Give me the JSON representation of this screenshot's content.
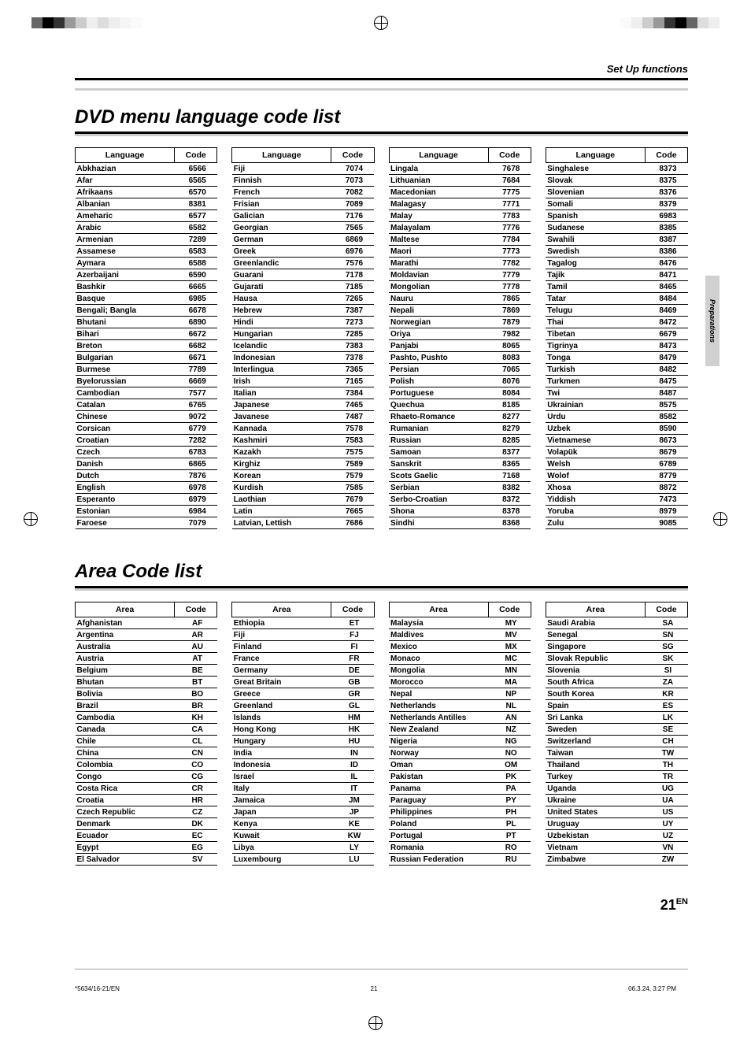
{
  "header": {
    "set_up": "Set Up functions"
  },
  "section1": {
    "title": "DVD menu language code list",
    "col_lang": "Language",
    "col_code": "Code",
    "columns": [
      [
        [
          "Abkhazian",
          "6566"
        ],
        [
          "Afar",
          "6565"
        ],
        [
          "Afrikaans",
          "6570"
        ],
        [
          "Albanian",
          "8381"
        ],
        [
          "Ameharic",
          "6577"
        ],
        [
          "Arabic",
          "6582"
        ],
        [
          "Armenian",
          "7289"
        ],
        [
          "Assamese",
          "6583"
        ],
        [
          "Aymara",
          "6588"
        ],
        [
          "Azerbaijani",
          "6590"
        ],
        [
          "Bashkir",
          "6665"
        ],
        [
          "Basque",
          "6985"
        ],
        [
          "Bengali; Bangla",
          "6678"
        ],
        [
          "Bhutani",
          "6890"
        ],
        [
          "Bihari",
          "6672"
        ],
        [
          "Breton",
          "6682"
        ],
        [
          "Bulgarian",
          "6671"
        ],
        [
          "Burmese",
          "7789"
        ],
        [
          "Byelorussian",
          "6669"
        ],
        [
          "Cambodian",
          "7577"
        ],
        [
          "Catalan",
          "6765"
        ],
        [
          "Chinese",
          "9072"
        ],
        [
          "Corsican",
          "6779"
        ],
        [
          "Croatian",
          "7282"
        ],
        [
          "Czech",
          "6783"
        ],
        [
          "Danish",
          "6865"
        ],
        [
          "Dutch",
          "7876"
        ],
        [
          "English",
          "6978"
        ],
        [
          "Esperanto",
          "6979"
        ],
        [
          "Estonian",
          "6984"
        ],
        [
          "Faroese",
          "7079"
        ]
      ],
      [
        [
          "Fiji",
          "7074"
        ],
        [
          "Finnish",
          "7073"
        ],
        [
          "French",
          "7082"
        ],
        [
          "Frisian",
          "7089"
        ],
        [
          "Galician",
          "7176"
        ],
        [
          "Georgian",
          "7565"
        ],
        [
          "German",
          "6869"
        ],
        [
          "Greek",
          "6976"
        ],
        [
          "Greenlandic",
          "7576"
        ],
        [
          "Guarani",
          "7178"
        ],
        [
          "Gujarati",
          "7185"
        ],
        [
          "Hausa",
          "7265"
        ],
        [
          "Hebrew",
          "7387"
        ],
        [
          "Hindi",
          "7273"
        ],
        [
          "Hungarian",
          "7285"
        ],
        [
          "Icelandic",
          "7383"
        ],
        [
          "Indonesian",
          "7378"
        ],
        [
          "Interlingua",
          "7365"
        ],
        [
          "Irish",
          "7165"
        ],
        [
          "Italian",
          "7384"
        ],
        [
          "Japanese",
          "7465"
        ],
        [
          "Javanese",
          "7487"
        ],
        [
          "Kannada",
          "7578"
        ],
        [
          "Kashmiri",
          "7583"
        ],
        [
          "Kazakh",
          "7575"
        ],
        [
          "Kirghiz",
          "7589"
        ],
        [
          "Korean",
          "7579"
        ],
        [
          "Kurdish",
          "7585"
        ],
        [
          "Laothian",
          "7679"
        ],
        [
          "Latin",
          "7665"
        ],
        [
          "Latvian, Lettish",
          "7686"
        ]
      ],
      [
        [
          "Lingala",
          "7678"
        ],
        [
          "Lithuanian",
          "7684"
        ],
        [
          "Macedonian",
          "7775"
        ],
        [
          "Malagasy",
          "7771"
        ],
        [
          "Malay",
          "7783"
        ],
        [
          "Malayalam",
          "7776"
        ],
        [
          "Maltese",
          "7784"
        ],
        [
          "Maori",
          "7773"
        ],
        [
          "Marathi",
          "7782"
        ],
        [
          "Moldavian",
          "7779"
        ],
        [
          "Mongolian",
          "7778"
        ],
        [
          "Nauru",
          "7865"
        ],
        [
          "Nepali",
          "7869"
        ],
        [
          "Norwegian",
          "7879"
        ],
        [
          "Oriya",
          "7982"
        ],
        [
          "Panjabi",
          "8065"
        ],
        [
          "Pashto, Pushto",
          "8083"
        ],
        [
          "Persian",
          "7065"
        ],
        [
          "Polish",
          "8076"
        ],
        [
          "Portuguese",
          "8084"
        ],
        [
          "Quechua",
          "8185"
        ],
        [
          "Rhaeto-Romance",
          "8277"
        ],
        [
          "Rumanian",
          "8279"
        ],
        [
          "Russian",
          "8285"
        ],
        [
          "Samoan",
          "8377"
        ],
        [
          "Sanskrit",
          "8365"
        ],
        [
          "Scots Gaelic",
          "7168"
        ],
        [
          "Serbian",
          "8382"
        ],
        [
          "Serbo-Croatian",
          "8372"
        ],
        [
          "Shona",
          "8378"
        ],
        [
          "Sindhi",
          "8368"
        ]
      ],
      [
        [
          "Singhalese",
          "8373"
        ],
        [
          "Slovak",
          "8375"
        ],
        [
          "Slovenian",
          "8376"
        ],
        [
          "Somali",
          "8379"
        ],
        [
          "Spanish",
          "6983"
        ],
        [
          "Sudanese",
          "8385"
        ],
        [
          "Swahili",
          "8387"
        ],
        [
          "Swedish",
          "8386"
        ],
        [
          "Tagalog",
          "8476"
        ],
        [
          "Tajik",
          "8471"
        ],
        [
          "Tamil",
          "8465"
        ],
        [
          "Tatar",
          "8484"
        ],
        [
          "Telugu",
          "8469"
        ],
        [
          "Thai",
          "8472"
        ],
        [
          "Tibetan",
          "6679"
        ],
        [
          "Tigrinya",
          "8473"
        ],
        [
          "Tonga",
          "8479"
        ],
        [
          "Turkish",
          "8482"
        ],
        [
          "Turkmen",
          "8475"
        ],
        [
          "Twi",
          "8487"
        ],
        [
          "Ukrainian",
          "8575"
        ],
        [
          "Urdu",
          "8582"
        ],
        [
          "Uzbek",
          "8590"
        ],
        [
          "Vietnamese",
          "8673"
        ],
        [
          "Volapük",
          "8679"
        ],
        [
          "Welsh",
          "6789"
        ],
        [
          "Wolof",
          "8779"
        ],
        [
          "Xhosa",
          "8872"
        ],
        [
          "Yiddish",
          "7473"
        ],
        [
          "Yoruba",
          "8979"
        ],
        [
          "Zulu",
          "9085"
        ]
      ]
    ]
  },
  "section2": {
    "title": "Area Code list",
    "col_area": "Area",
    "col_code": "Code",
    "columns": [
      [
        [
          "Afghanistan",
          "AF"
        ],
        [
          "Argentina",
          "AR"
        ],
        [
          "Australia",
          "AU"
        ],
        [
          "Austria",
          "AT"
        ],
        [
          "Belgium",
          "BE"
        ],
        [
          "Bhutan",
          "BT"
        ],
        [
          "Bolivia",
          "BO"
        ],
        [
          "Brazil",
          "BR"
        ],
        [
          "Cambodia",
          "KH"
        ],
        [
          "Canada",
          "CA"
        ],
        [
          "Chile",
          "CL"
        ],
        [
          "China",
          "CN"
        ],
        [
          "Colombia",
          "CO"
        ],
        [
          "Congo",
          "CG"
        ],
        [
          "Costa Rica",
          "CR"
        ],
        [
          "Croatia",
          "HR"
        ],
        [
          "Czech Republic",
          "CZ"
        ],
        [
          "Denmark",
          "DK"
        ],
        [
          "Ecuador",
          "EC"
        ],
        [
          "Egypt",
          "EG"
        ],
        [
          "El Salvador",
          "SV"
        ]
      ],
      [
        [
          "Ethiopia",
          "ET"
        ],
        [
          "Fiji",
          "FJ"
        ],
        [
          "Finland",
          "FI"
        ],
        [
          "France",
          "FR"
        ],
        [
          "Germany",
          "DE"
        ],
        [
          "Great Britain",
          "GB"
        ],
        [
          "Greece",
          "GR"
        ],
        [
          "Greenland",
          "GL"
        ],
        [
          "Islands",
          "HM"
        ],
        [
          "Hong Kong",
          "HK"
        ],
        [
          "Hungary",
          "HU"
        ],
        [
          "India",
          "IN"
        ],
        [
          "Indonesia",
          "ID"
        ],
        [
          "Israel",
          "IL"
        ],
        [
          "Italy",
          "IT"
        ],
        [
          "Jamaica",
          "JM"
        ],
        [
          "Japan",
          "JP"
        ],
        [
          "Kenya",
          "KE"
        ],
        [
          "Kuwait",
          "KW"
        ],
        [
          "Libya",
          "LY"
        ],
        [
          "Luxembourg",
          "LU"
        ]
      ],
      [
        [
          "Malaysia",
          "MY"
        ],
        [
          "Maldives",
          "MV"
        ],
        [
          "Mexico",
          "MX"
        ],
        [
          "Monaco",
          "MC"
        ],
        [
          "Mongolia",
          "MN"
        ],
        [
          "Morocco",
          "MA"
        ],
        [
          "Nepal",
          "NP"
        ],
        [
          "Netherlands",
          "NL"
        ],
        [
          "Netherlands Antilles",
          "AN"
        ],
        [
          "New Zealand",
          "NZ"
        ],
        [
          "Nigeria",
          "NG"
        ],
        [
          "Norway",
          "NO"
        ],
        [
          "Oman",
          "OM"
        ],
        [
          "Pakistan",
          "PK"
        ],
        [
          "Panama",
          "PA"
        ],
        [
          "Paraguay",
          "PY"
        ],
        [
          "Philippines",
          "PH"
        ],
        [
          "Poland",
          "PL"
        ],
        [
          "Portugal",
          "PT"
        ],
        [
          "Romania",
          "RO"
        ],
        [
          "Russian Federation",
          "RU"
        ]
      ],
      [
        [
          "Saudi Arabia",
          "SA"
        ],
        [
          "Senegal",
          "SN"
        ],
        [
          "Singapore",
          "SG"
        ],
        [
          "Slovak Republic",
          "SK"
        ],
        [
          "Slovenia",
          "SI"
        ],
        [
          "South Africa",
          "ZA"
        ],
        [
          "South Korea",
          "KR"
        ],
        [
          "Spain",
          "ES"
        ],
        [
          "Sri Lanka",
          "LK"
        ],
        [
          "Sweden",
          "SE"
        ],
        [
          "Switzerland",
          "CH"
        ],
        [
          "Taiwan",
          "TW"
        ],
        [
          "Thailand",
          "TH"
        ],
        [
          "Turkey",
          "TR"
        ],
        [
          "Uganda",
          "UG"
        ],
        [
          "Ukraine",
          "UA"
        ],
        [
          "United States",
          "US"
        ],
        [
          "Uruguay",
          "UY"
        ],
        [
          "Uzbekistan",
          "UZ"
        ],
        [
          "Vietnam",
          "VN"
        ],
        [
          "Zimbabwe",
          "ZW"
        ]
      ]
    ]
  },
  "side_tab": "Preparations",
  "page_number": "21",
  "page_suffix": "EN",
  "footer": {
    "left": "*5634/16-21/EN",
    "center": "21",
    "right": "06.3.24, 3:27 PM"
  }
}
